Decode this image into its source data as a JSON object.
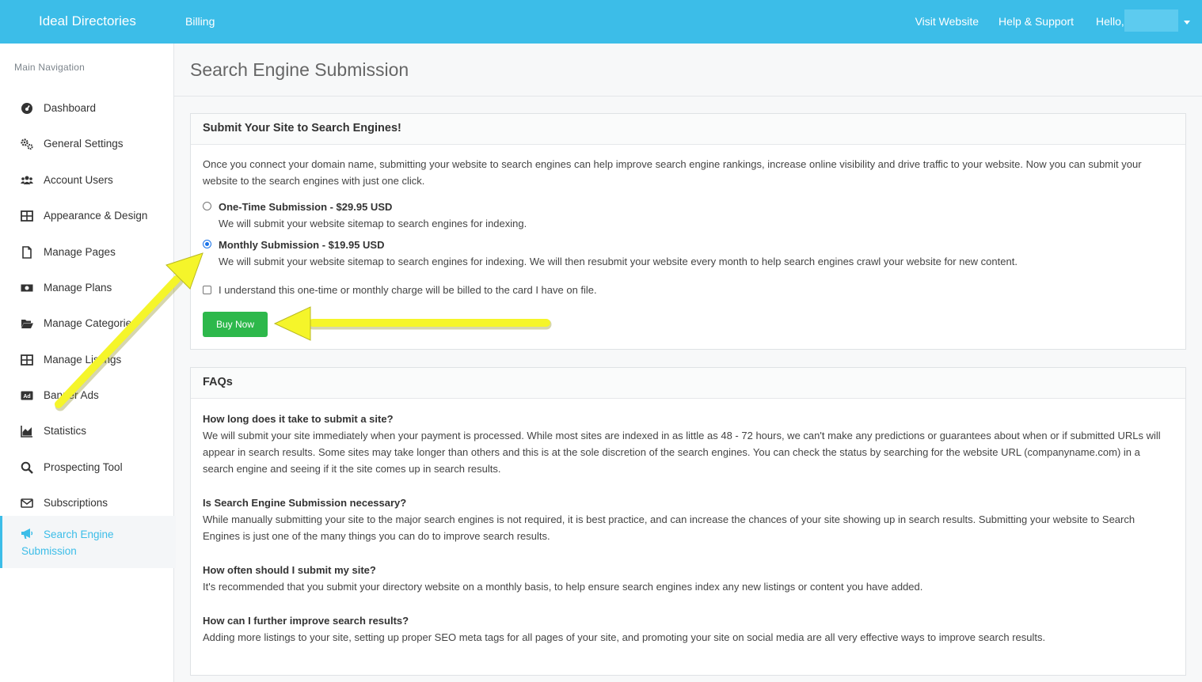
{
  "header": {
    "brand": "Ideal Directories",
    "billing": "Billing",
    "visit_website": "Visit Website",
    "help_support": "Help & Support",
    "hello": "Hello,",
    "accent": "#3cbde8"
  },
  "sidebar": {
    "title": "Main Navigation",
    "items": [
      {
        "label": "Dashboard",
        "icon": "dashboard-icon"
      },
      {
        "label": "General Settings",
        "icon": "gears-icon"
      },
      {
        "label": "Account Users",
        "icon": "users-icon"
      },
      {
        "label": "Appearance & Design",
        "icon": "grid-icon"
      },
      {
        "label": "Manage Pages",
        "icon": "file-icon"
      },
      {
        "label": "Manage Plans",
        "icon": "money-icon"
      },
      {
        "label": "Manage Categories",
        "icon": "folder-open-icon"
      },
      {
        "label": "Manage Listings",
        "icon": "grid-icon"
      },
      {
        "label": "Banner Ads",
        "icon": "ad-icon"
      },
      {
        "label": "Statistics",
        "icon": "area-chart-icon"
      },
      {
        "label": "Prospecting Tool",
        "icon": "search-icon"
      },
      {
        "label": "Subscriptions",
        "icon": "envelope-icon"
      },
      {
        "label": "Search Engine Submission",
        "icon": "bullhorn-icon",
        "active": true
      }
    ]
  },
  "main": {
    "page_title": "Search Engine Submission",
    "submit_panel": {
      "heading": "Submit Your Site to Search Engines!",
      "intro": "Once you connect your domain name, submitting your website to search engines can help improve search engine rankings, increase online visibility and drive traffic to your website. Now you can submit your website to the search engines with just one click.",
      "options": [
        {
          "title": "One-Time Submission - $29.95 USD",
          "desc": "We will submit your website sitemap to search engines for indexing.",
          "selected": false
        },
        {
          "title": "Monthly Submission - $19.95 USD",
          "desc": "We will submit your website sitemap to search engines for indexing. We will then resubmit your website every month to help search engines crawl your website for new content.",
          "selected": true
        }
      ],
      "agree_label": "I understand this one-time or monthly charge will be billed to the card I have on file.",
      "agree_checked": false,
      "buy_label": "Buy Now",
      "buy_color": "#2db84b"
    },
    "faq_panel": {
      "heading": "FAQs",
      "items": [
        {
          "q": "How long does it take to submit a site?",
          "a": "We will submit your site immediately when your payment is processed. While most sites are indexed in as little as 48 - 72 hours, we can't make any predictions or guarantees about when or if submitted URLs will appear in search results. Some sites may take longer than others and this is at the sole discretion of the search engines. You can check the status by searching for the website URL (companyname.com) in a search engine and seeing if it the site comes up in search results."
        },
        {
          "q": "Is Search Engine Submission necessary?",
          "a": "While manually submitting your site to the major search engines is not required, it is best practice, and can increase the chances of your site showing up in search results. Submitting your website to Search Engines is just one of the many things you can do to improve search results."
        },
        {
          "q": "How often should I submit my site?",
          "a": "It's recommended that you submit your directory website on a monthly basis, to help ensure search engines index any new listings or content you have added."
        },
        {
          "q": "How can I further improve search results?",
          "a": "Adding more listings to your site, setting up proper SEO meta tags for all pages of your site, and promoting your site on social media are all very effective ways to improve search results."
        }
      ]
    }
  },
  "annotations": {
    "arrow_color": "#f5f52a"
  }
}
